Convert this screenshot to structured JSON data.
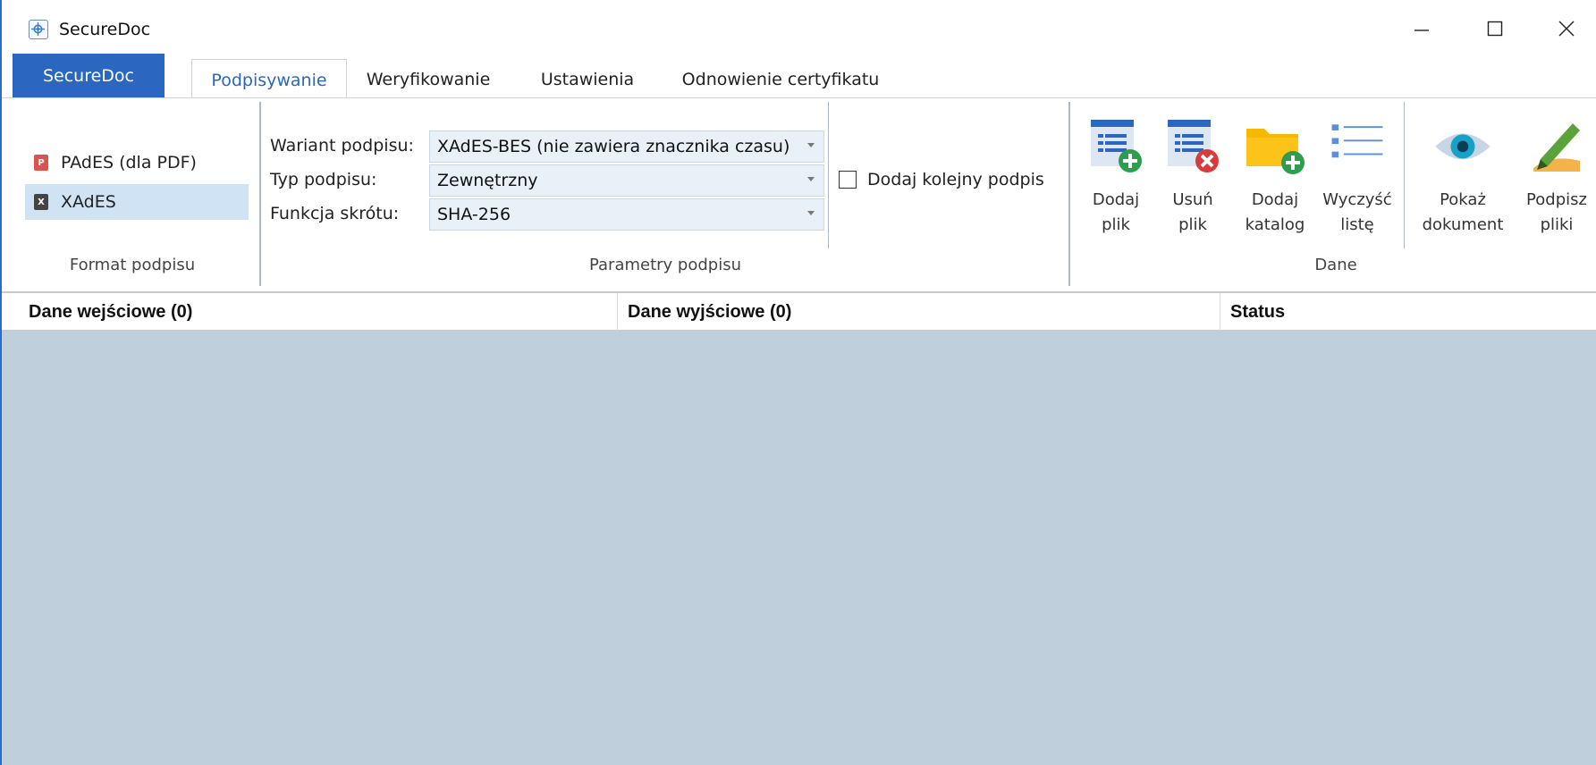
{
  "window": {
    "title": "SecureDoc",
    "app_icon": "securedoc-logo-icon",
    "controls": [
      "minimize-icon",
      "maximize-icon",
      "close-icon"
    ]
  },
  "tabs": {
    "app_tab": "SecureDoc",
    "items": [
      "Podpisywanie",
      "Weryfikowanie",
      "Ustawienia",
      "Odnowienie certyfikatu"
    ],
    "active": "Podpisywanie"
  },
  "ribbon": {
    "format_group": {
      "label": "Format podpisu",
      "items": [
        {
          "label": "PAdES (dla PDF)",
          "icon": "pdf-file-icon",
          "selected": false
        },
        {
          "label": "XAdES",
          "icon": "xml-file-icon",
          "selected": true
        }
      ]
    },
    "params_group": {
      "label": "Parametry podpisu",
      "variant_label": "Wariant podpisu:",
      "variant_value": "XAdES-BES (nie zawiera znacznika czasu)",
      "type_label": "Typ podpisu:",
      "type_value": "Zewnętrzny",
      "hash_label": "Funkcja skrótu:",
      "hash_value": "SHA-256",
      "add_signature_label": "Dodaj kolejny podpis",
      "add_signature_checked": false
    },
    "data_group": {
      "label": "Dane",
      "buttons": [
        {
          "line1": "Dodaj",
          "line2": "plik",
          "icon": "add-file-icon"
        },
        {
          "line1": "Usuń",
          "line2": "plik",
          "icon": "remove-file-icon"
        },
        {
          "line1": "Dodaj",
          "line2": "katalog",
          "icon": "add-folder-icon"
        },
        {
          "line1": "Wyczyść",
          "line2": "listę",
          "icon": "clear-list-icon"
        },
        {
          "line1": "Pokaż",
          "line2": "dokument",
          "icon": "eye-icon"
        },
        {
          "line1": "Podpisz",
          "line2": "pliki",
          "icon": "sign-pen-icon"
        }
      ]
    }
  },
  "table": {
    "columns": [
      "Dane wejściowe (0)",
      "Dane wyjściowe (0)",
      "Status"
    ],
    "rows": []
  },
  "colors": {
    "accent": "#2b66c0",
    "selected_bg": "#cfe3f4",
    "list_bg": "#c0cfdc"
  }
}
